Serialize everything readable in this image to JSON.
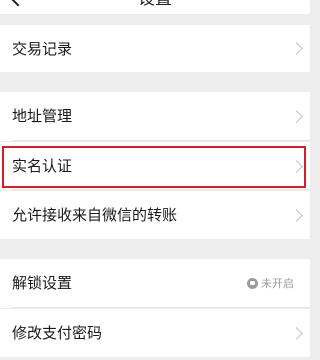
{
  "header": {
    "title": "设置"
  },
  "rows": [
    {
      "label": "交易记录"
    },
    {
      "label": "地址管理"
    },
    {
      "label": "实名认证"
    },
    {
      "label": "允许接收来自微信的转账"
    },
    {
      "label": "解锁设置",
      "status": "未开启"
    },
    {
      "label": "修改支付密码"
    }
  ],
  "colors": {
    "highlight": "#d0202a",
    "background": "#ededed"
  },
  "icons": [
    "back-icon",
    "chevron-right-icon",
    "lock-icon"
  ]
}
